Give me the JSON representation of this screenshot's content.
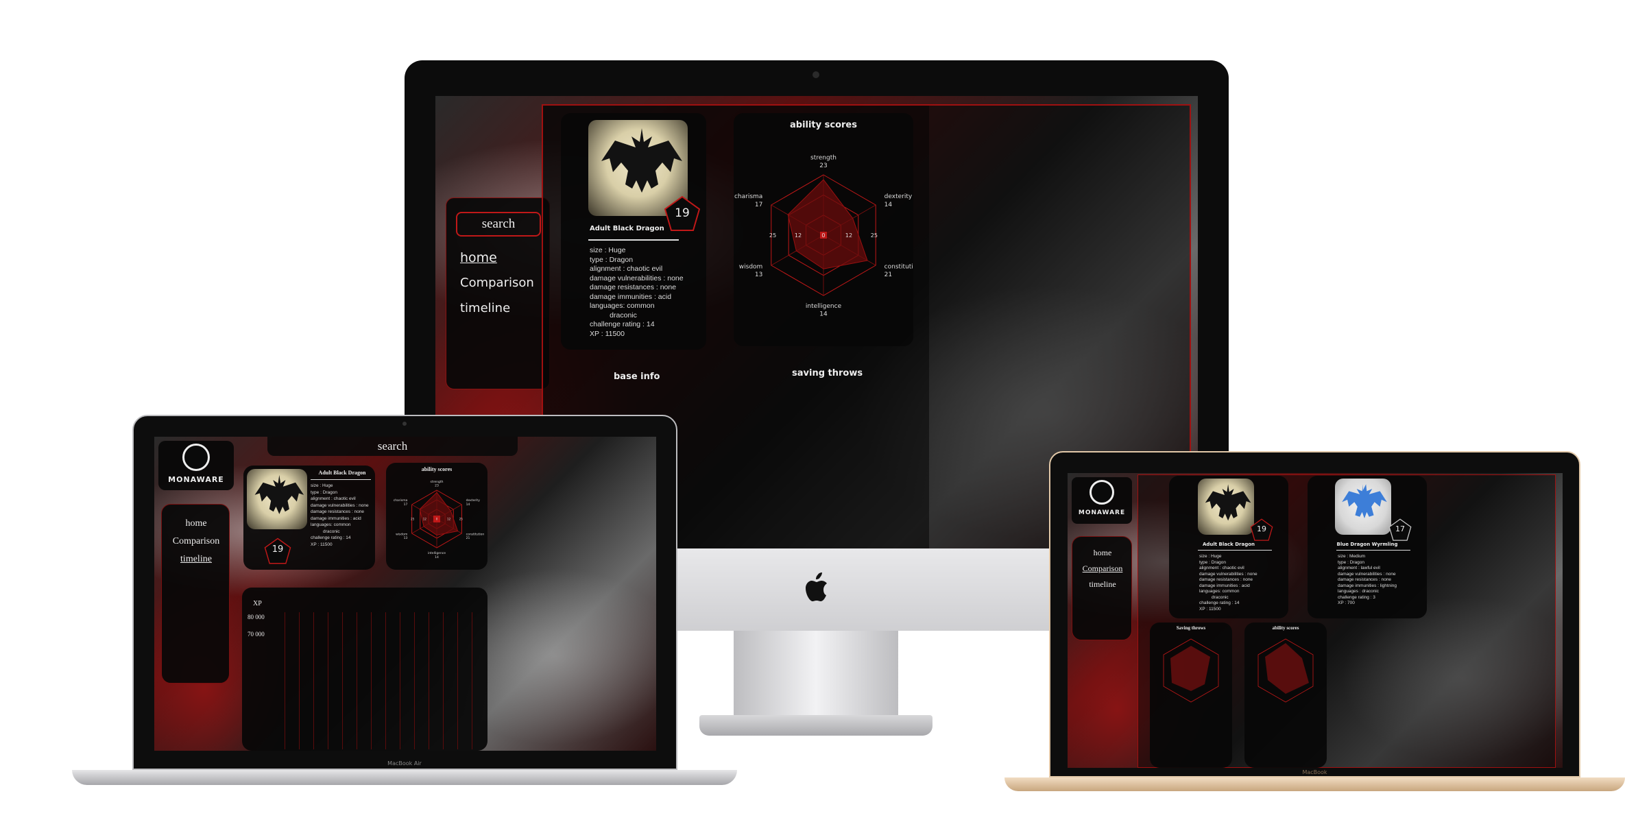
{
  "brand": {
    "name": "MONAWARE"
  },
  "nav": {
    "search": "search",
    "home": "home",
    "comparison": "Comparison",
    "timeline": "timeline"
  },
  "monster1": {
    "name": "Adult Black Dragon",
    "rating": "19",
    "details": [
      "size : Huge",
      "type : Dragon",
      "alignment : chaotic evil",
      "damage vulnerabilities : none",
      "damage resistances : none",
      "damage immunities : acid",
      "languages: common",
      "          draconic",
      "challenge rating : 14",
      "XP : 11500"
    ]
  },
  "monster2": {
    "name": "Blue Dragon Wyrmling",
    "rating": "17",
    "details": [
      "size : Medium",
      "type : Dragon",
      "alignment : lawful evil",
      "damage vulnerabilities : none",
      "damage resistances : none",
      "damage immunities : lightning",
      "languages : draconic",
      "challenge rating : 3",
      "XP : 700"
    ]
  },
  "sections": {
    "ability_scores": "ability scores",
    "saving_throws": "saving throws",
    "saving_throws_cap": "Saving throws",
    "base_info": "base info",
    "xp": "XP"
  },
  "chart_data": {
    "type": "radar",
    "title": "ability scores",
    "categories": [
      "strength",
      "dexterity",
      "constitution",
      "intelligence",
      "wisdom",
      "charisma"
    ],
    "values": [
      23,
      14,
      21,
      14,
      13,
      17
    ],
    "ring_labels": [
      "0",
      "12",
      "25"
    ],
    "range": [
      0,
      25
    ]
  },
  "xp_chart": {
    "ticks": [
      "80 000",
      "70 000"
    ]
  },
  "devices": {
    "laptop_label": "MacBook Air",
    "macbook_label": "MacBook"
  },
  "colors": {
    "accent": "#c01818",
    "bg": "#0a0a0a",
    "gold": "#e2c8a8",
    "silver": "#d6d6d6"
  }
}
